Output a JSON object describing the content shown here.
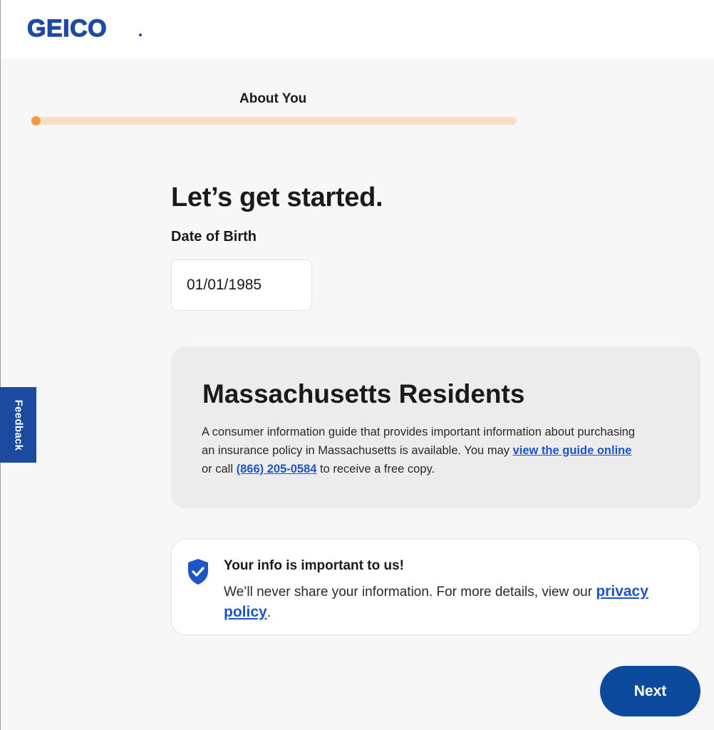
{
  "header": {
    "logo_text": "GEICO"
  },
  "progress": {
    "step_label": "About You",
    "fraction": 0.0
  },
  "main": {
    "title": "Let’s get started.",
    "dob": {
      "label": "Date of Birth",
      "value": "01/01/1985"
    }
  },
  "ma_notice": {
    "title": "Massachusetts Residents",
    "text_before": "A consumer information guide that provides important information about purchasing an insurance policy in Massachusetts is available. You may ",
    "guide_link": "view the guide online",
    "text_middle": " or call ",
    "phone_link": "(866) 205-0584",
    "text_after": " to receive a free copy."
  },
  "privacy_notice": {
    "title": "Your info is important to us!",
    "text": "We’ll never share your information. For more details, view our ",
    "link": "privacy policy",
    "suffix": ".",
    "icon": "shield-check-icon"
  },
  "feedback": {
    "label": "Feedback"
  },
  "actions": {
    "next_label": "Next"
  },
  "colors": {
    "brand_blue": "#1b4aa0",
    "button_blue": "#0c4a9e",
    "link_blue": "#1d55c8",
    "progress_track": "#f8dfc3",
    "progress_fill": "#f09a3e",
    "page_bg": "#f7f7f7",
    "notice_bg": "#ececec"
  }
}
